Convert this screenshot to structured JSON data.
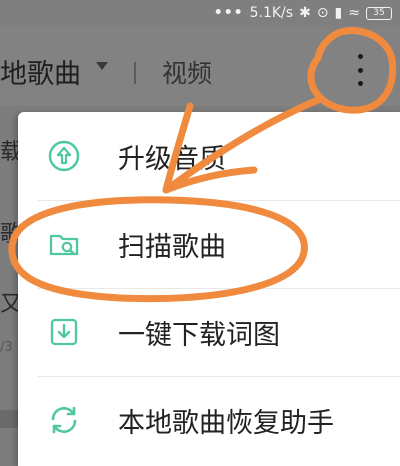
{
  "status_bar": {
    "speed": "5.1K/s",
    "battery": "35"
  },
  "header": {
    "title": "地歌曲",
    "video_tab": "视频"
  },
  "background": {
    "frag_1": "载",
    "frag_2": "歌",
    "frag_3": "又",
    "frag_4": "/3"
  },
  "menu": {
    "items": [
      {
        "label": "升级音质",
        "icon": "upgrade-quality-icon"
      },
      {
        "label": "扫描歌曲",
        "icon": "scan-folder-icon"
      },
      {
        "label": "一键下载词图",
        "icon": "download-icon"
      },
      {
        "label": "本地歌曲恢复助手",
        "icon": "restore-icon"
      }
    ]
  },
  "colors": {
    "accent": "#4fc7a0",
    "annotation": "#f08a3e",
    "dim_bg": "#7c7c7c"
  }
}
